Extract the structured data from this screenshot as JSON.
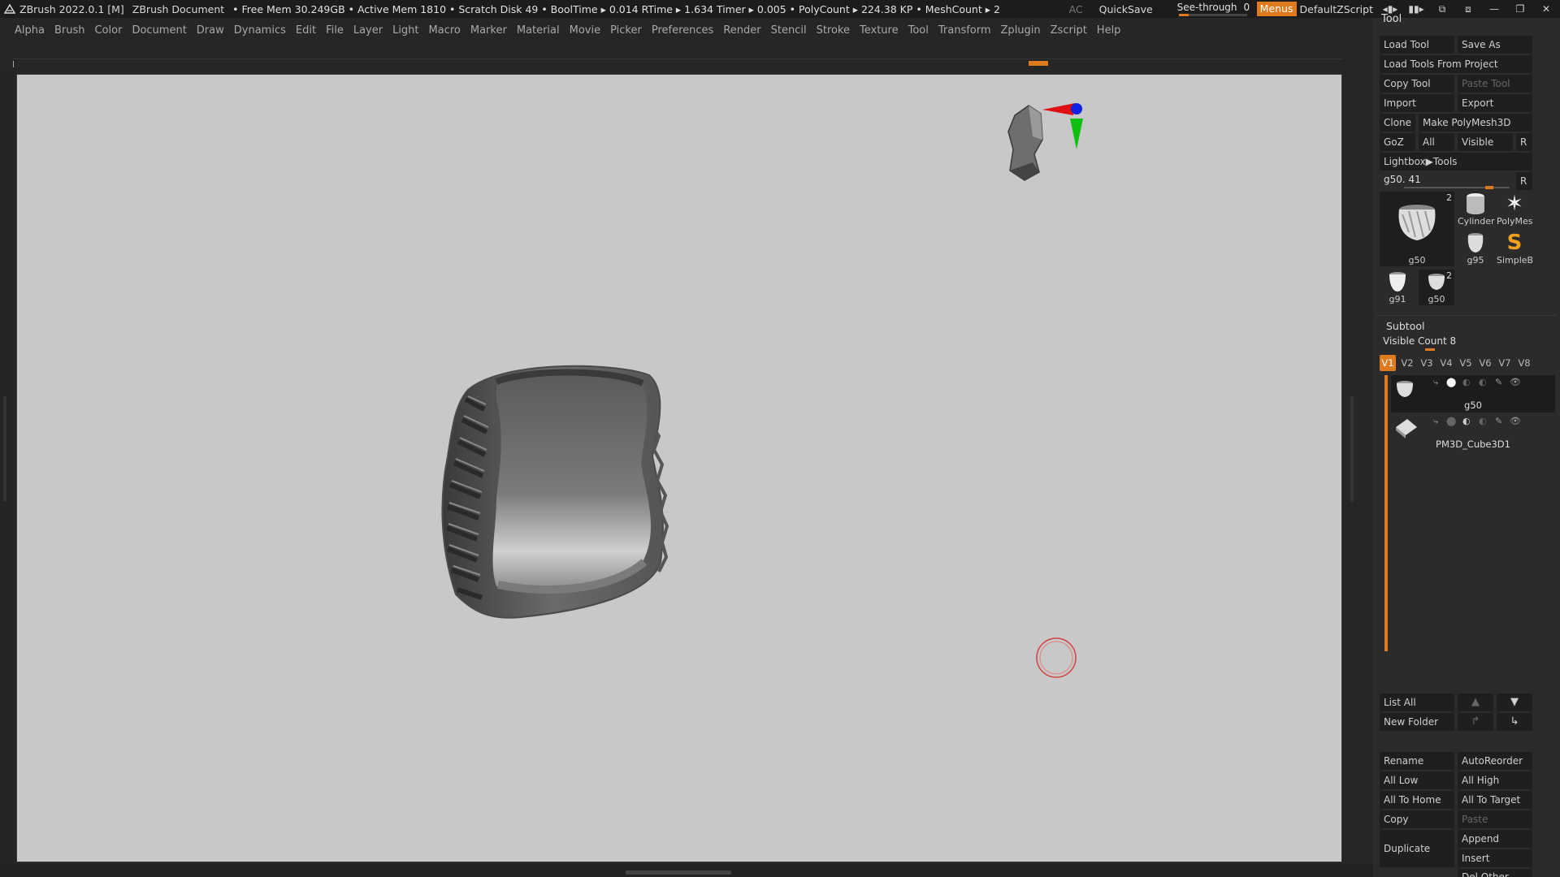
{
  "titlebar": {
    "app": "ZBrush 2022.0.1 [M]",
    "document": "ZBrush Document",
    "stats": "• Free Mem 30.249GB • Active Mem 1810 • Scratch Disk 49 •  BoolTime ▸ 0.014 RTime ▸ 1.634 Timer ▸ 0.005 • PolyCount ▸ 224.38 KP  • MeshCount ▸ 2",
    "ac": "AC",
    "quicksave": "QuickSave",
    "seethrough_label": "See-through",
    "seethrough_value": "0",
    "seethrough_level": 0,
    "menus": "Menus",
    "script": "DefaultZScript"
  },
  "menubar": [
    "Alpha",
    "Brush",
    "Color",
    "Document",
    "Draw",
    "Dynamics",
    "Edit",
    "File",
    "Layer",
    "Light",
    "Macro",
    "Marker",
    "Material",
    "Movie",
    "Picker",
    "Preferences",
    "Render",
    "Stencil",
    "Stroke",
    "Texture",
    "Tool",
    "Transform",
    "Zplugin",
    "Zscript",
    "Help"
  ],
  "tool_panel": {
    "title": "Tool",
    "load_tool": "Load Tool",
    "save_as": "Save As",
    "load_tools_from_project": "Load Tools From Project",
    "copy_tool": "Copy Tool",
    "paste_tool": "Paste Tool",
    "import": "Import",
    "export": "Export",
    "clone": "Clone",
    "make_polymesh": "Make PolyMesh3D",
    "goz": "GoZ",
    "all": "All",
    "visible": "Visible",
    "r": "R",
    "lightbox": "Lightbox▶Tools",
    "slider_label": "g50. 41",
    "slider_r": "R",
    "thumbs": {
      "main": {
        "label": "g50",
        "count": "2"
      },
      "cylinder": "Cylinder",
      "polymesh": "PolyMes",
      "g95": "g95",
      "simpleb": "SimpleB",
      "g91": "g91",
      "g50b": {
        "label": "g50",
        "count": "2"
      }
    }
  },
  "subtool": {
    "title": "Subtool",
    "visible_count": "Visible Count 8",
    "vtabs": [
      "V1",
      "V2",
      "V3",
      "V4",
      "V5",
      "V6",
      "V7",
      "V8"
    ],
    "items": [
      "g50",
      "PM3D_Cube3D1"
    ],
    "list_all": "List All",
    "new_folder": "New Folder",
    "rename": "Rename",
    "autoreorder": "AutoReorder",
    "all_low": "All Low",
    "all_high": "All High",
    "all_to_home": "All To Home",
    "all_to_target": "All To Target",
    "copy": "Copy",
    "paste": "Paste",
    "duplicate": "Duplicate",
    "append": "Append",
    "insert": "Insert",
    "del_other": "Del Other"
  },
  "colors": {
    "accent": "#e07a1f",
    "canvas": "#c8c8c8",
    "panel": "#2b2b2b"
  }
}
